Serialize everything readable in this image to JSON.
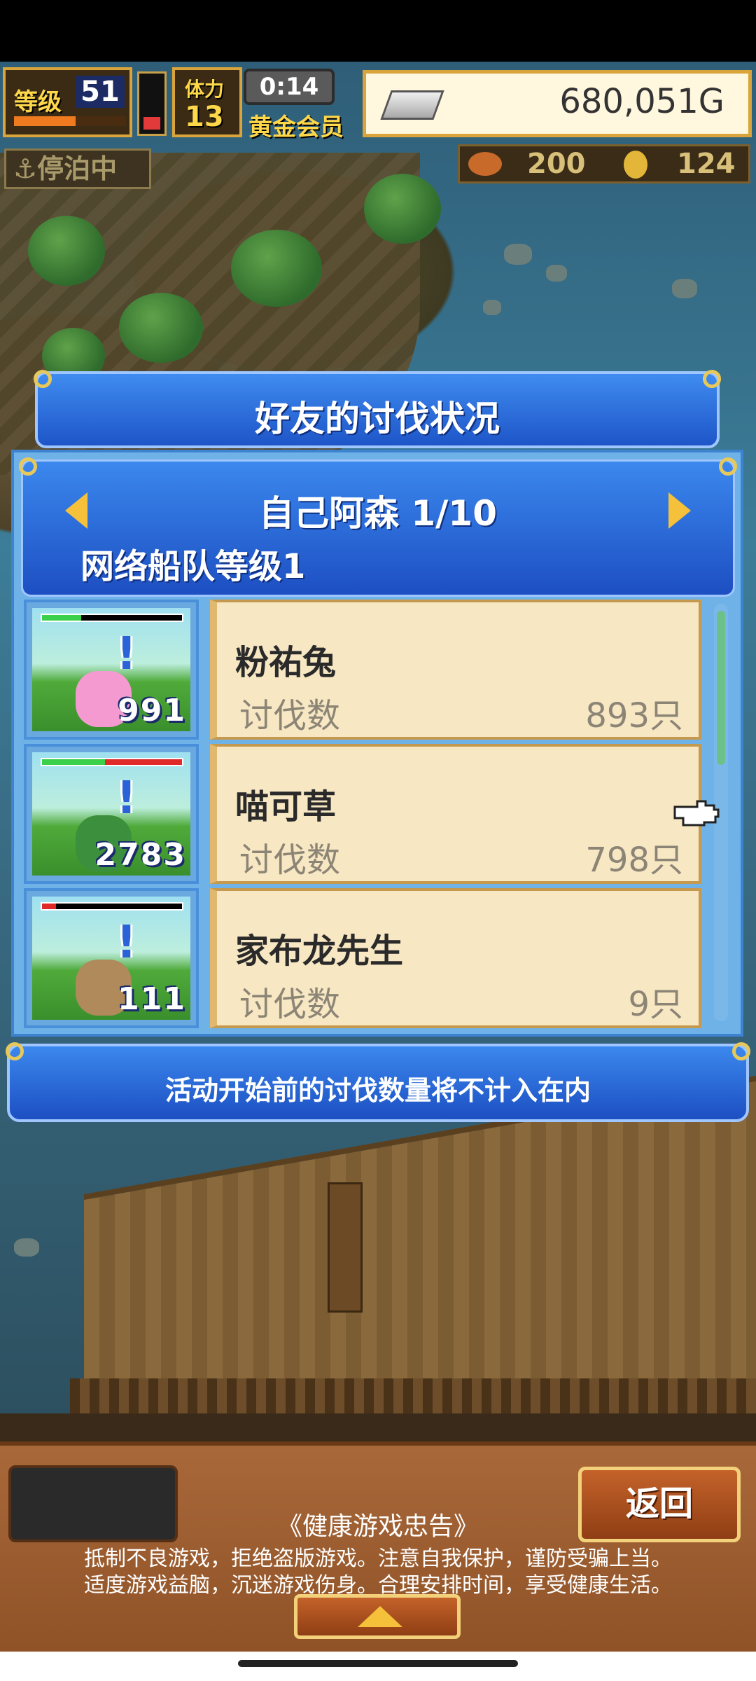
{
  "hud": {
    "level_label": "等级",
    "level_value": "51",
    "exp_progress": 0.55,
    "hp_fraction": 0.25,
    "stamina_label": "体力",
    "stamina_value": "13",
    "timer": "0:14",
    "member_status": "黄金会员",
    "money": "680,051G",
    "status_text": "停泊中",
    "resource1_value": "200",
    "resource2_value": "124"
  },
  "dialog": {
    "title": "好友的讨伐状况",
    "friend_label": "自己阿森 1/10",
    "fleet_level": "网络船队等级1",
    "kills_label": "讨伐数",
    "monsters": [
      {
        "name": "粉祐兔",
        "kills": "893只",
        "count_badge": "991",
        "hp_green": 0.28,
        "hp_red": 0.0,
        "color": "#f59ad0"
      },
      {
        "name": "喵可草",
        "kills": "798只",
        "count_badge": "2783",
        "hp_green": 0.45,
        "hp_red": 0.55,
        "color": "#3c8f3c"
      },
      {
        "name": "家布龙先生",
        "kills": "9只",
        "count_badge": "111",
        "hp_green": 0.0,
        "hp_red": 0.1,
        "color": "#b08a5a"
      }
    ],
    "notice": "活动开始前的讨伐数量将不计入在内"
  },
  "footer": {
    "back_label": "返回",
    "advisory_title": "《健康游戏忠告》",
    "advisory_line1": "抵制不良游戏，拒绝盗版游戏。注意自我保护，谨防受骗上当。",
    "advisory_line2": "适度游戏益脑，沉迷游戏伤身。合理安排时间，享受健康生活。"
  }
}
